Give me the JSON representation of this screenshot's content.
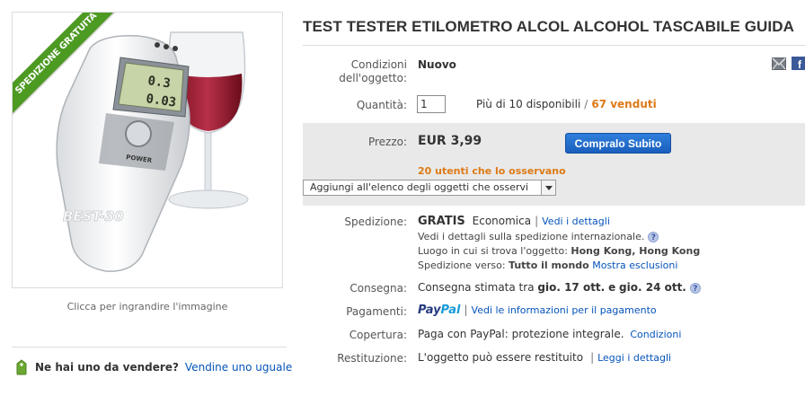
{
  "product": {
    "title": "TEST TESTER ETILOMETRO ALCOL ALCOHOL TASCABILE GUIDA",
    "ribbon_text": "SPEDIZIONE GRATUITA",
    "device_display_top": "0.3",
    "device_display_bottom": "0.03",
    "device_button": "POWER",
    "watermark": "BEST-30",
    "image_caption": "Clicca per ingrandire l'immagine"
  },
  "sell": {
    "question": "Ne hai uno da vendere?",
    "link": "Vendine uno uguale"
  },
  "condition": {
    "label": "Condizioni dell'oggetto:",
    "value": "Nuovo"
  },
  "quantity": {
    "label": "Quantità:",
    "input_value": "1",
    "available": "Più di 10 disponibili",
    "sold": "67 venduti"
  },
  "price": {
    "label": "Prezzo:",
    "value": "EUR 3,99",
    "buy_button": "Compralo Subito",
    "watchers": "20 utenti che lo osservano",
    "watch_select": "Aggiungi all'elenco degli oggetti che osservi"
  },
  "shipping": {
    "label": "Spedizione:",
    "free": "GRATIS",
    "method": "Economica",
    "details_link": "Vedi i dettagli",
    "intl_text": "Vedi i dettagli sulla spedizione internazionale.",
    "location_label": "Luogo in cui si trova l'oggetto:",
    "location_value": "Hong Kong, Hong Kong",
    "ship_to_label": "Spedizione verso:",
    "ship_to_value": "Tutto il mondo",
    "exclusions_link": "Mostra esclusioni"
  },
  "delivery": {
    "label": "Consegna:",
    "prefix": "Consegna stimata tra",
    "date1": "gio. 17 ott.",
    "conj": "e",
    "date2": "gio. 24 ott."
  },
  "payments": {
    "label": "Pagamenti:",
    "paypal_1": "Pay",
    "paypal_2": "Pal",
    "info_link": "Vedi le informazioni per il pagamento"
  },
  "coverage": {
    "label": "Copertura:",
    "text": "Paga con PayPal: protezione integrale.",
    "link": "Condizioni"
  },
  "returns": {
    "label": "Restituzione:",
    "text": "L'oggetto può essere restituito",
    "link": "Leggi i dettagli"
  },
  "icons": {
    "email": "email-icon",
    "facebook": "facebook-icon",
    "info": "info-icon",
    "tag": "price-tag-icon",
    "dropdown": "chevron-down-icon"
  },
  "colors": {
    "link": "#0654ba",
    "orange": "#dd7a16",
    "ribbon": "#4d9a23",
    "button": "#1b5fbd",
    "price_band": "#e9e9e9"
  }
}
